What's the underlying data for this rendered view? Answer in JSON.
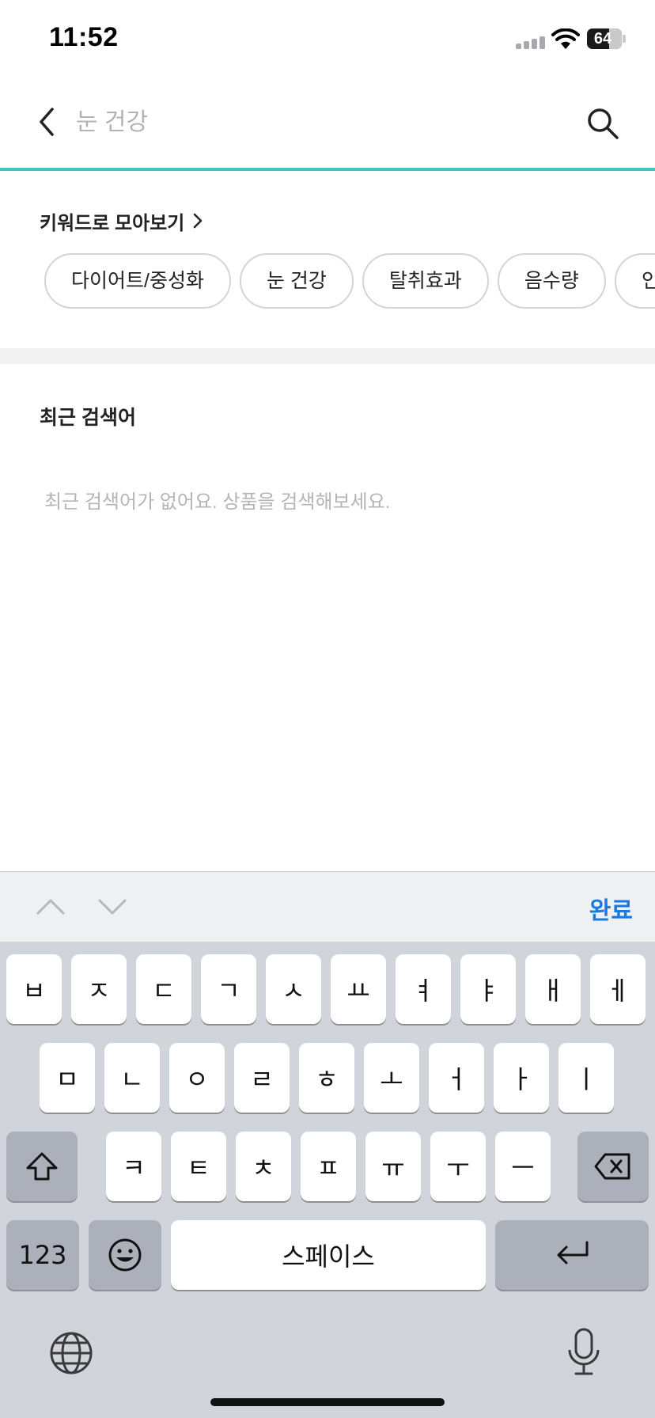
{
  "status_bar": {
    "time": "11:52",
    "battery": "64",
    "battery_level": 0.64
  },
  "search": {
    "placeholder": "눈 건강",
    "back_icon": "chevron-left-icon",
    "search_icon": "search-icon",
    "accent_color": "#3cc4c9"
  },
  "keywords": {
    "title": "키워드로 모아보기",
    "chips": [
      "다이어트/중성화",
      "눈 건강",
      "탈취효과",
      "음수량",
      "인테리어"
    ]
  },
  "recent": {
    "title": "최근 검색어",
    "empty_message": "최근 검색어가 없어요. 상품을 검색해보세요."
  },
  "keyboard_accessory": {
    "done_label": "완료",
    "done_color": "#1a7ae0"
  },
  "keyboard": {
    "row1": [
      "ㅂ",
      "ㅈ",
      "ㄷ",
      "ㄱ",
      "ㅅ",
      "ㅛ",
      "ㅕ",
      "ㅑ",
      "ㅐ",
      "ㅔ"
    ],
    "row2": [
      "ㅁ",
      "ㄴ",
      "ㅇ",
      "ㄹ",
      "ㅎ",
      "ㅗ",
      "ㅓ",
      "ㅏ",
      "ㅣ"
    ],
    "row3": [
      "ㅋ",
      "ㅌ",
      "ㅊ",
      "ㅍ",
      "ㅠ",
      "ㅜ",
      "ㅡ"
    ],
    "numbers_label": "123",
    "space_label": "스페이스"
  }
}
